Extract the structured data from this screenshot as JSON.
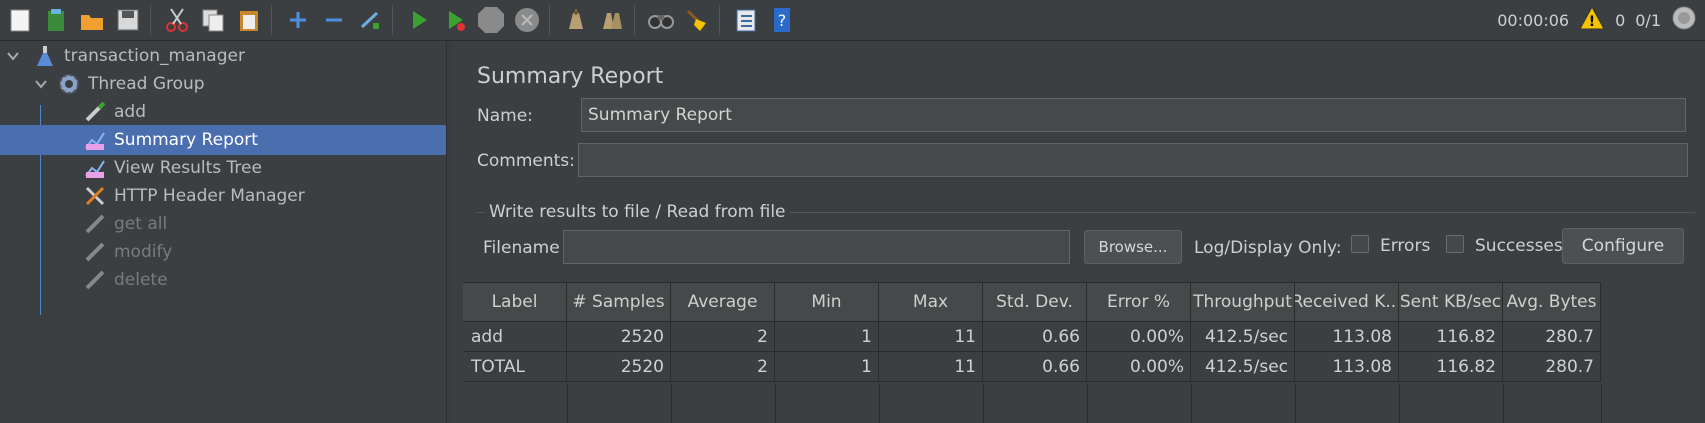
{
  "toolbar": {
    "icons": [
      "new-icon",
      "templates-icon",
      "open-icon",
      "save-icon",
      "cut-icon",
      "copy-icon",
      "paste-icon",
      "expand-icon",
      "collapse-icon",
      "toggle-icon",
      "start-icon",
      "start-no-pauses-icon",
      "stop-icon",
      "shutdown-icon",
      "clear-icon",
      "clear-all-icon",
      "search-icon",
      "reset-search-icon",
      "function-helper-icon",
      "help-icon"
    ],
    "timer": "00:00:06",
    "warnings": "0",
    "threads": "0/1"
  },
  "tree": {
    "items": [
      {
        "label": "transaction_manager",
        "icon": "test-plan-icon",
        "level": 0,
        "expanded": true
      },
      {
        "label": "Thread Group",
        "icon": "gear-icon",
        "level": 1,
        "expanded": true
      },
      {
        "label": "add",
        "icon": "pipette-icon",
        "level": 2
      },
      {
        "label": "Summary Report",
        "icon": "chart-icon",
        "level": 2,
        "selected": true
      },
      {
        "label": "View Results Tree",
        "icon": "chart-icon",
        "level": 2
      },
      {
        "label": "HTTP Header Manager",
        "icon": "tools-icon",
        "level": 2
      },
      {
        "label": "get all",
        "icon": "pipette-icon",
        "level": 2,
        "disabled": true
      },
      {
        "label": "modify",
        "icon": "pipette-icon",
        "level": 2,
        "disabled": true
      },
      {
        "label": "delete",
        "icon": "pipette-icon",
        "level": 2,
        "disabled": true
      }
    ]
  },
  "panel": {
    "title": "Summary Report",
    "name_label": "Name:",
    "name_value": "Summary Report",
    "comments_label": "Comments:",
    "comments_value": "",
    "file_group_title": "Write results to file / Read from file",
    "filename_label": "Filename",
    "filename_value": "",
    "browse_label": "Browse...",
    "log_display_label": "Log/Display Only:",
    "errors_label": "Errors",
    "successes_label": "Successes",
    "configure_label": "Configure"
  },
  "table": {
    "headers": [
      "Label",
      "# Samples",
      "Average",
      "Min",
      "Max",
      "Std. Dev.",
      "Error %",
      "Throughput",
      "Received K...",
      "Sent KB/sec",
      "Avg. Bytes"
    ],
    "rows": [
      [
        "add",
        "2520",
        "2",
        "1",
        "11",
        "0.66",
        "0.00%",
        "412.5/sec",
        "113.08",
        "116.82",
        "280.7"
      ],
      [
        "TOTAL",
        "2520",
        "2",
        "1",
        "11",
        "0.66",
        "0.00%",
        "412.5/sec",
        "113.08",
        "116.82",
        "280.7"
      ]
    ]
  },
  "colors": {
    "background": "#3c3f41",
    "selection": "#4b6eaf",
    "warning": "#f5c400",
    "run_green": "#3ba22f"
  }
}
